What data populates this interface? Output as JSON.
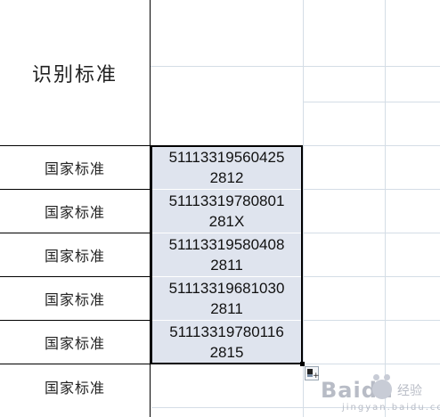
{
  "header": {
    "label": "识别标准"
  },
  "rows": [
    {
      "label": "国家标准",
      "value_line1": "51113319560425",
      "value_line2": "2812"
    },
    {
      "label": "国家标准",
      "value_line1": "51113319780801",
      "value_line2": "281X"
    },
    {
      "label": "国家标准",
      "value_line1": "51113319580408",
      "value_line2": "2811"
    },
    {
      "label": "国家标准",
      "value_line1": "51113319681030",
      "value_line2": "2811"
    },
    {
      "label": "国家标准",
      "value_line1": "51113319780116",
      "value_line2": "2815"
    }
  ],
  "partial_row": {
    "label": "国家标准"
  },
  "watermark": {
    "brand": "Baidu",
    "suffix": "经验",
    "url_text": "jingyan.baidu.com"
  },
  "colors": {
    "selection_fill": "#dfe4ee",
    "gridline": "#d4dde6",
    "border": "#000000"
  }
}
